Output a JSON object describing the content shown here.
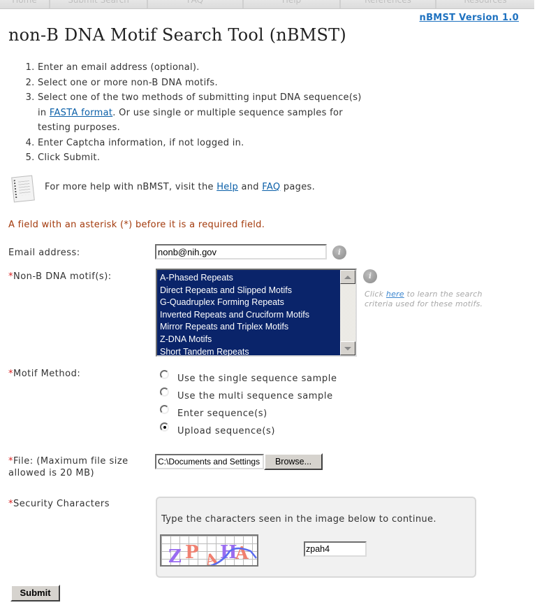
{
  "nav": {
    "tabs": [
      {
        "label": "Home"
      },
      {
        "label": "Submit Search"
      },
      {
        "label": "FAQ"
      },
      {
        "label": "Help"
      },
      {
        "label": "References"
      },
      {
        "label": "Resources"
      }
    ]
  },
  "version_link": "nBMST Version 1.0",
  "title": "non-B DNA Motif Search Tool (nBMST)",
  "steps": [
    "Enter an email address (optional).",
    "Select one or more non-B DNA motifs.",
    {
      "before": "Select one of the two methods of submitting input DNA sequence(s) in ",
      "link": "FASTA format",
      "after": ". Or use single or multiple sequence samples for testing purposes."
    },
    "Enter Captcha information, if not logged in.",
    "Click Submit."
  ],
  "help": {
    "before": "For more help with nBMST, visit the ",
    "help_link": "Help",
    "middle": " and ",
    "faq_link": "FAQ",
    "after": " pages."
  },
  "required_note": "A field with an asterisk (*) before it is a required field.",
  "form": {
    "asterisk": "*",
    "email": {
      "label": "Email address:",
      "value": "nonb@nih.gov"
    },
    "motifs": {
      "label": "Non-B DNA motif(s):",
      "options": [
        "A-Phased Repeats",
        "Direct Repeats and Slipped Motifs",
        "G-Quadruplex Forming Repeats",
        "Inverted Repeats and Cruciform Motifs",
        "Mirror Repeats and Triplex Motifs",
        "Z-DNA Motifs",
        "Short Tandem Repeats"
      ],
      "all_selected": true,
      "hint_before": "Click ",
      "hint_link": "here",
      "hint_after": " to learn the search criteria used for these motifs."
    },
    "method": {
      "label": "Motif Method:",
      "options": [
        {
          "label": "Use the single sequence sample",
          "checked": false
        },
        {
          "label": "Use the multi sequence sample",
          "checked": false
        },
        {
          "label": "Enter sequence(s)",
          "checked": false
        },
        {
          "label": "Upload sequence(s)",
          "checked": true
        }
      ]
    },
    "file": {
      "label_line1": "File: (Maximum file size",
      "label_line2": "allowed is 20 MB)",
      "value": "C:\\Documents and Settings",
      "browse_label": "Browse..."
    },
    "security": {
      "label": "Security Characters",
      "prompt": "Type the characters seen in the image below to continue.",
      "captcha_glyphs": [
        "Z",
        "P",
        "A",
        "H",
        "A"
      ],
      "value": "zpah4"
    },
    "submit_label": "Submit"
  },
  "colors": {
    "link": "#0a5fa8",
    "required_note": "#a33a0c",
    "asterisk": "#d81f1f",
    "selection_bg": "#0a246a"
  }
}
